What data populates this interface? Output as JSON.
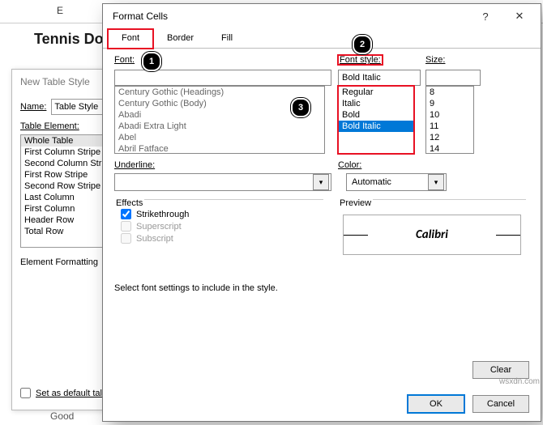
{
  "sheet": {
    "column_label": "E",
    "title": "Tennis Do"
  },
  "nts": {
    "title": "New Table Style",
    "name_label": "Name:",
    "name_value": "Table Style",
    "table_element_label": "Table Element:",
    "elements": [
      "Whole Table",
      "First Column Stripe",
      "Second Column Stripe",
      "First Row Stripe",
      "Second Row Stripe",
      "Last Column",
      "First Column",
      "Header Row",
      "Total Row"
    ],
    "element_formatting_label": "Element Formatting",
    "set_default_label": "Set as default tal"
  },
  "dialog": {
    "title": "Format Cells",
    "help_icon": "?",
    "close_icon": "✕",
    "tabs": {
      "font": "Font",
      "border": "Border",
      "fill": "Fill"
    },
    "labels": {
      "font": "Font:",
      "style": "Font style:",
      "size": "Size:",
      "underline": "Underline:",
      "color": "Color:",
      "effects": "Effects",
      "preview": "Preview"
    },
    "font_value": "",
    "style_value": "Bold Italic",
    "size_value": "",
    "font_list": [
      "Century Gothic (Headings)",
      "Century Gothic (Body)",
      "Abadi",
      "Abadi Extra Light",
      "Abel",
      "Abril Fatface"
    ],
    "style_list": [
      "Regular",
      "Italic",
      "Bold",
      "Bold Italic"
    ],
    "size_list": [
      "8",
      "9",
      "10",
      "11",
      "12",
      "14"
    ],
    "color_value": "Automatic",
    "effects": {
      "strike": "Strikethrough",
      "superscript": "Superscript",
      "subscript": "Subscript"
    },
    "preview_text": "Calibri",
    "note": "Select font settings to include in the style.",
    "buttons": {
      "clear": "Clear",
      "ok": "OK",
      "cancel": "Cancel"
    }
  },
  "misc": {
    "good": "Good",
    "watermark": "wsxdn.com"
  }
}
